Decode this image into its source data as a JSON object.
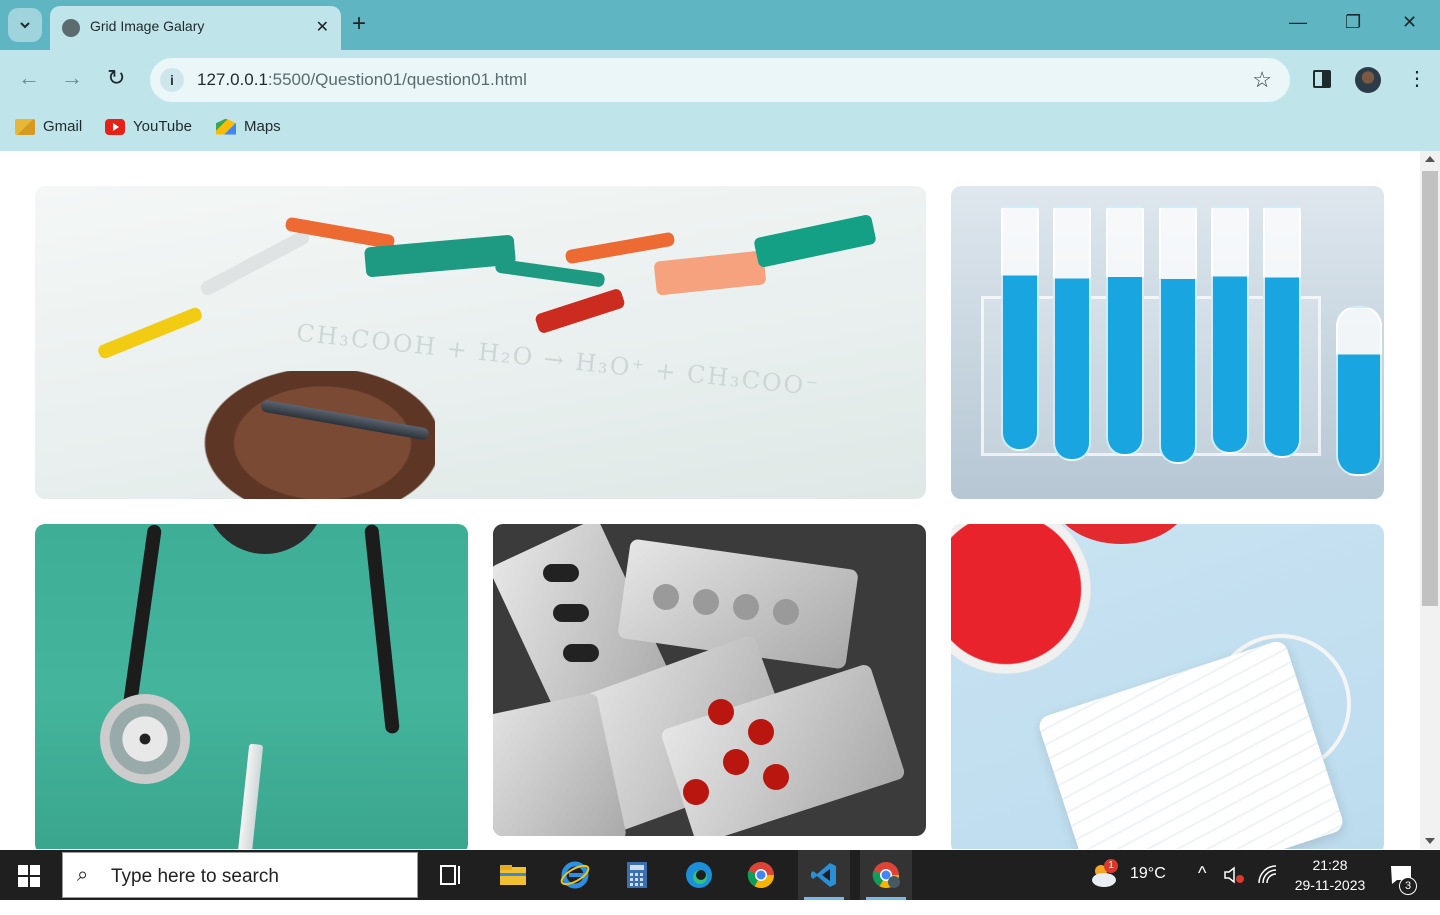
{
  "browser": {
    "tab_title": "Grid Image Galary",
    "tab_close": "✕",
    "new_tab": "+",
    "url_host": "127.0.0.1",
    "url_rest": ":5500/Question01/question01.html",
    "info_icon": "i",
    "star_icon": "☆",
    "menu_icon": "⋮",
    "win_minimize": "—",
    "win_restore": "❐",
    "win_close": "✕",
    "back": "←",
    "forward": "→",
    "reload": "↻"
  },
  "bookmarks": [
    {
      "label": "Gmail",
      "icon": "gmail-icon"
    },
    {
      "label": "YouTube",
      "icon": "youtube-icon"
    },
    {
      "label": "Maps",
      "icon": "maps-icon"
    }
  ],
  "gallery": {
    "images": [
      {
        "subject": "molecule-model-whiteboard",
        "formula": "CH₃COOH + H₂O → H₃O⁺ + CH₃COO⁻"
      },
      {
        "subject": "blue-test-tubes"
      },
      {
        "subject": "doctor-stethoscope-syringe"
      },
      {
        "subject": "pill-blister-packs"
      },
      {
        "subject": "petri-dish-face-mask"
      }
    ]
  },
  "taskbar": {
    "search_placeholder": "Type here to search",
    "search_icon": "⌕",
    "weather_temp": "19°C",
    "weather_badge": "1",
    "time": "21:28",
    "date": "29-11-2023",
    "notification_count": "3",
    "tray_chevron": "^"
  },
  "colors": {
    "tabstrip": "#5fb5c2",
    "toolbar": "#bfe4ea",
    "taskbar": "#1f1f1f"
  }
}
